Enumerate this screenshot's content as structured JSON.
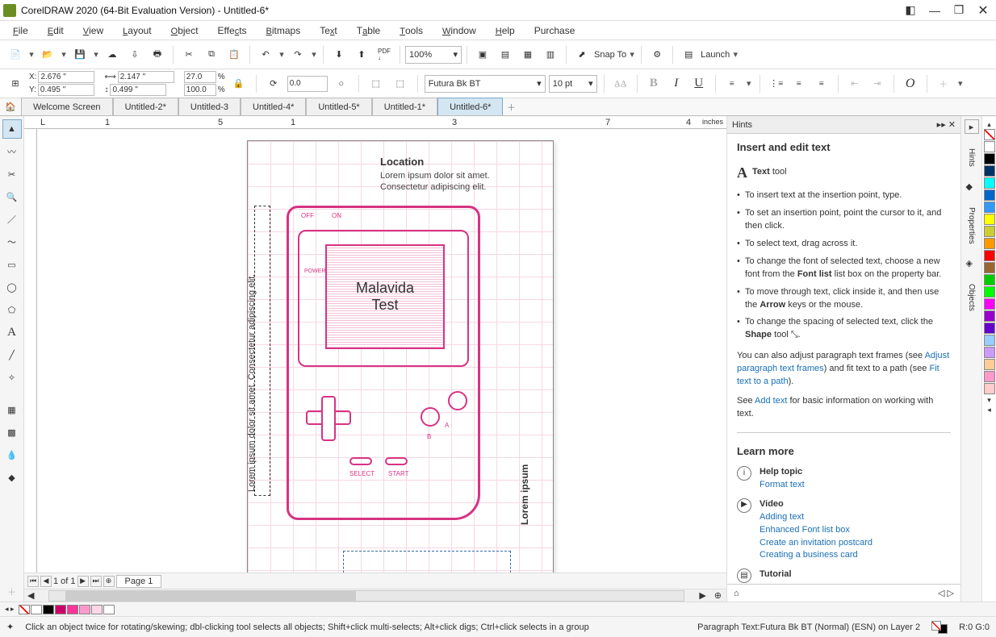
{
  "title": "CorelDRAW 2020 (64-Bit Evaluation Version) - Untitled-6*",
  "menus": [
    "File",
    "Edit",
    "View",
    "Layout",
    "Object",
    "Effects",
    "Bitmaps",
    "Text",
    "Table",
    "Tools",
    "Window",
    "Help",
    "Purchase"
  ],
  "toolbar": {
    "zoom": "100%",
    "snap": "Snap To",
    "launch": "Launch"
  },
  "propbar": {
    "x": "2.676 \"",
    "y": "0.495 \"",
    "w": "2.147 \"",
    "h": "0.499 \"",
    "sx": "27.0",
    "sy": "100.0",
    "pct": "%",
    "rot": "0.0",
    "font": "Futura Bk BT",
    "size": "10 pt"
  },
  "tabs": {
    "welcome": "Welcome Screen",
    "items": [
      "Untitled-2*",
      "Untitled-3",
      "Untitled-4*",
      "Untitled-5*",
      "Untitled-1*",
      "Untitled-6*"
    ],
    "active": "Untitled-6*"
  },
  "ruler": {
    "units": "inches",
    "marks": [
      "1",
      "5",
      "1",
      "3",
      "7",
      "4"
    ]
  },
  "canvas": {
    "location_title": "Location",
    "location_body": "Lorem ipsum dolor sit amet. Consectetur adipiscing elit.",
    "vtext": "Lorem ipsum dolor sit amet. Consectetur adipiscing elit.",
    "vtext_bold": "Lorem ipsum dolor sit amet.",
    "vtext2": "Lorem ipsum",
    "screen_l1": "Malavida",
    "screen_l2": "Test",
    "off": "OFF",
    "on": "ON",
    "power": "POWER",
    "select": "SELECT",
    "start": "START",
    "a": "A",
    "b": "B"
  },
  "page_nav": {
    "range": "1 of 1",
    "page": "Page 1"
  },
  "hints": {
    "panel_title": "Hints",
    "heading": "Insert and edit text",
    "tool": "Text",
    "tool_suffix": " tool",
    "b1": "To insert text at the insertion point, type.",
    "b2": "To set an insertion point, point the cursor to it, and then click.",
    "b3": "To select text, drag across it.",
    "b4a": "To change the font of selected text, choose a new font from the ",
    "b4b": "Font list",
    "b4c": " list box on the property bar.",
    "b5a": "To move through text, click inside it, and then use the ",
    "b5b": "Arrow",
    "b5c": " keys or the mouse.",
    "b6a": "To change the spacing of selected text, click the ",
    "b6b": "Shape",
    "b6c": " tool ",
    "p1a": "You can also adjust paragraph text frames (see ",
    "p1b": "Adjust paragraph text frames",
    "p1c": ") and fit text to a path (see ",
    "p1d": "Fit text to a path",
    "p1e": ").",
    "p2a": "See ",
    "p2b": "Add text",
    "p2c": " for basic information on working with text.",
    "learn": "Learn more",
    "help": "Help topic",
    "help_l": "Format text",
    "video": "Video",
    "v1": "Adding text",
    "v2": "Enhanced Font list box",
    "v3": "Create an invitation postcard",
    "v4": "Creating a business card",
    "tut": "Tutorial"
  },
  "docks": [
    "Hints",
    "Properties",
    "Objects"
  ],
  "palette": [
    "#ffffff",
    "#000000",
    "#003366",
    "#00ffff",
    "#0066cc",
    "#3399ff",
    "#ffff00",
    "#cccc33",
    "#ff9900",
    "#ff0000",
    "#996633",
    "#00cc00",
    "#00ff00",
    "#ff00ff",
    "#9900cc",
    "#6600cc",
    "#99ccff",
    "#cc99ff",
    "#ffcc99",
    "#ff99cc",
    "#ffcccc"
  ],
  "color_row": [
    "#ffffff",
    "#000000",
    "#cc0066",
    "#ff3399",
    "#ff99cc",
    "#ffd6e8",
    "#ffffff"
  ],
  "status": {
    "hint": "Click an object twice for rotating/skewing; dbl-clicking tool selects all objects; Shift+click multi-selects; Alt+click digs; Ctrl+click selects in a group",
    "obj": "Paragraph Text:Futura Bk BT (Normal) (ESN) on Layer 2",
    "rgb": "R:0 G:0"
  }
}
